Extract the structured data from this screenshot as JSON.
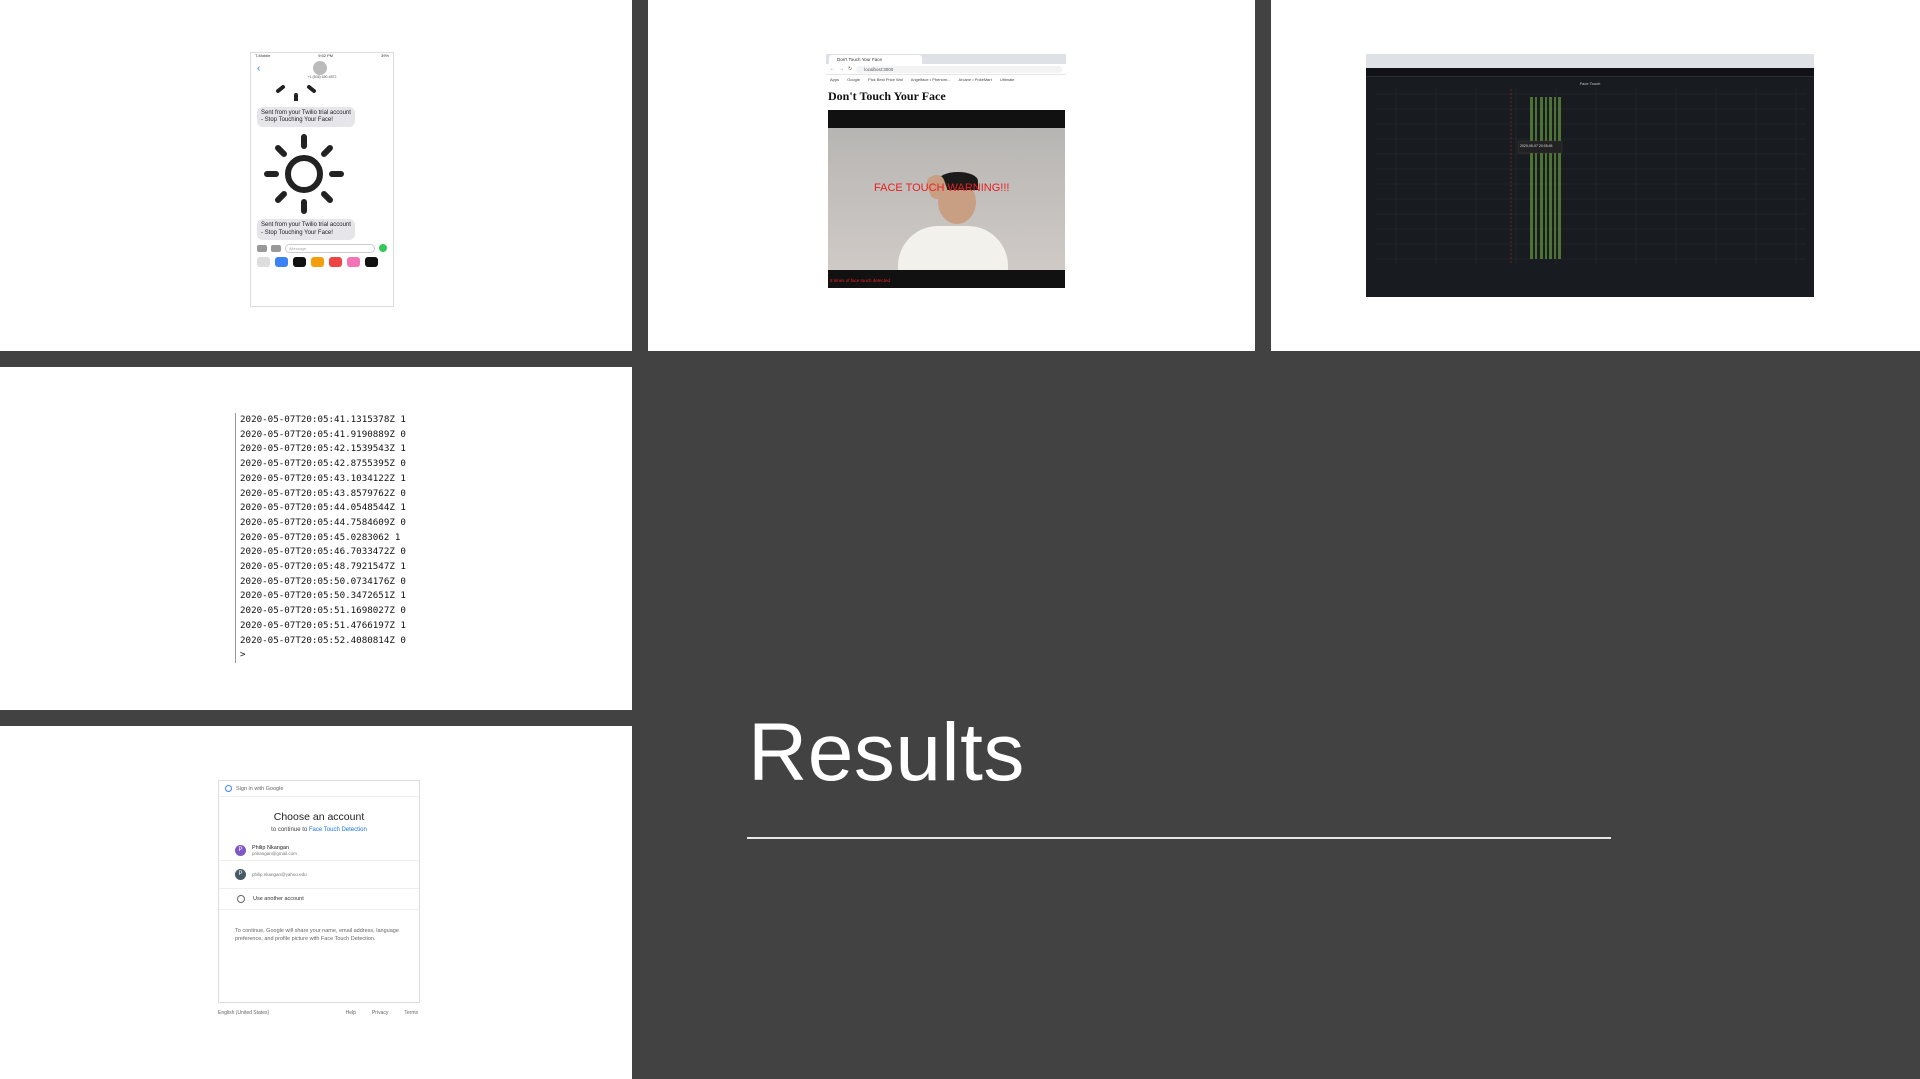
{
  "phone": {
    "carrier": "T-Mobile",
    "time": "9:52 PM",
    "battery": "39%",
    "contact_number": "+1 (605) 690-4872",
    "messages": [
      "Sent from your Twilio trial account - Stop Touching Your Face!",
      "Sent from your Twilio trial account - Stop Touching Your Face!"
    ],
    "input_placeholder": "iMessage"
  },
  "browser": {
    "tab_title": "Don't Touch Your Face",
    "url": "localhost:3000",
    "bookmarks": [
      "Apps",
      "Google",
      "Pick Best Price Wal",
      "Angelface • Phenom...",
      "Arcane • PokeMart",
      "Ultimate"
    ],
    "page_heading": "Don't Touch Your Face",
    "warning": "FACE TOUCH WARNING!!!",
    "caption": "8 times of face touch detected"
  },
  "dashboard": {
    "panel_title": "Face Touch",
    "tooltip": "2020-05-07 20:05:45"
  },
  "log": {
    "lines": [
      "2020-05-07T20:05:41.1315378Z 1",
      "2020-05-07T20:05:41.9190889Z 0",
      "2020-05-07T20:05:42.1539543Z 1",
      "2020-05-07T20:05:42.8755395Z 0",
      "2020-05-07T20:05:43.1034122Z 1",
      "2020-05-07T20:05:43.8579762Z 0",
      "2020-05-07T20:05:44.0548544Z 1",
      "2020-05-07T20:05:44.7584609Z 0",
      "2020-05-07T20:05:45.0283062  1",
      "2020-05-07T20:05:46.7033472Z 0",
      "2020-05-07T20:05:48.7921547Z 1",
      "2020-05-07T20:05:50.0734176Z 0",
      "2020-05-07T20:05:50.3472651Z 1",
      "2020-05-07T20:05:51.1698027Z 0",
      "2020-05-07T20:05:51.4766197Z 1",
      "2020-05-07T20:05:52.4080814Z 0"
    ],
    "prompt": ">"
  },
  "signin": {
    "header": "Sign in with Google",
    "title": "Choose an account",
    "subtitle_prefix": "to continue to ",
    "app_name": "Face Touch Detection",
    "accounts": [
      {
        "initial": "P",
        "name": "Philip Nkangan",
        "email": "pnkangan@gmail.com"
      },
      {
        "initial": "P",
        "name": "",
        "email": "philip.nkangan@yahoo.edu"
      }
    ],
    "use_another": "Use another account",
    "disclaimer": "To continue, Google will share your name, email address, language preference, and profile picture with Face Touch Detection.",
    "footer": {
      "language": "English (United States)",
      "help": "Help",
      "privacy": "Privacy",
      "terms": "Terms"
    }
  },
  "slide": {
    "title": "Results"
  }
}
